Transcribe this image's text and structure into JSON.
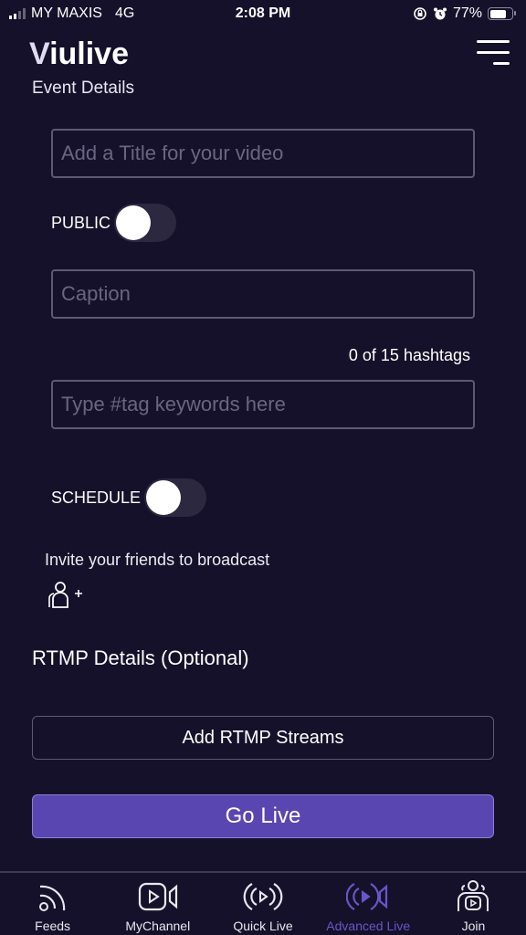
{
  "status_bar": {
    "carrier": "MY MAXIS",
    "network": "4G",
    "time": "2:08 PM",
    "battery_percent": "77%",
    "battery_level": 0.77
  },
  "header": {
    "logo": "Viulive",
    "subtitle": "Event Details"
  },
  "form": {
    "title_placeholder": "Add a Title for your video",
    "title_value": "",
    "public_label": "PUBLIC",
    "public_on": false,
    "caption_placeholder": "Caption",
    "caption_value": "",
    "hashtag_count": "0 of 15 hashtags",
    "hashtag_placeholder": "Type #tag keywords here",
    "hashtag_value": "",
    "schedule_label": "SCHEDULE",
    "schedule_on": false,
    "invite_text": "Invite your friends to broadcast"
  },
  "rtmp": {
    "title": "RTMP Details (Optional)",
    "add_button": "Add RTMP Streams"
  },
  "go_live_button": "Go Live",
  "colors": {
    "background": "#15112a",
    "accent": "#5a46b0",
    "active_tab": "#6a55c8"
  },
  "tabs": [
    {
      "label": "Feeds",
      "icon": "feeds-icon",
      "active": false
    },
    {
      "label": "MyChannel",
      "icon": "my-channel-icon",
      "active": false
    },
    {
      "label": "Quick Live",
      "icon": "quick-live-icon",
      "active": false
    },
    {
      "label": "Advanced Live",
      "icon": "advanced-live-icon",
      "active": true
    },
    {
      "label": "Join",
      "icon": "join-icon",
      "active": false
    }
  ]
}
